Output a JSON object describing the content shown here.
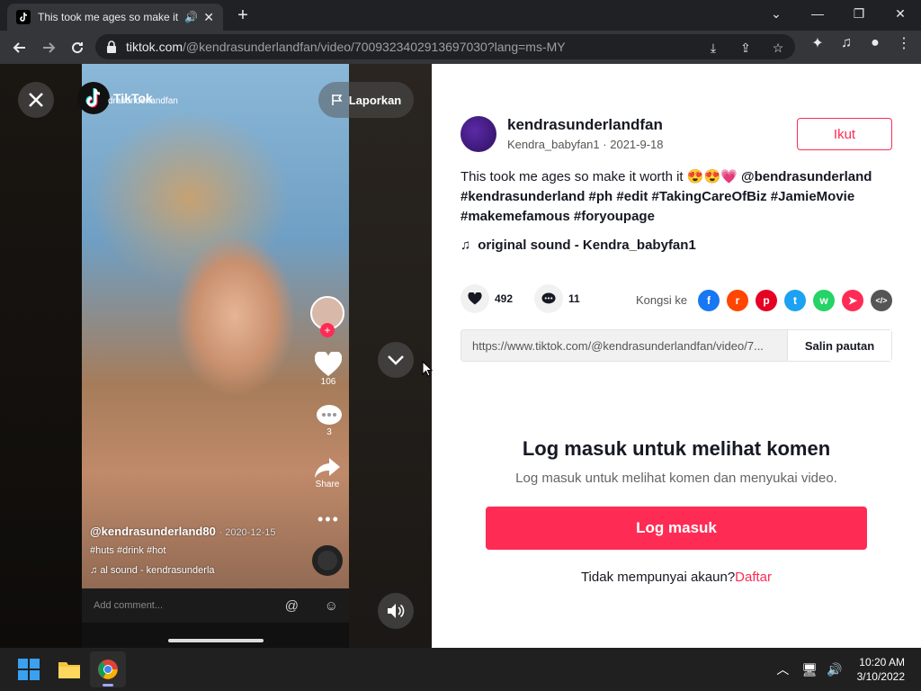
{
  "browser": {
    "tab_title": "This took me ages so make it",
    "url_host": "tiktok.com",
    "url_path": "/@kendrasunderlandfan/video/7009323402913697030?lang=ms-MY"
  },
  "video": {
    "logo_text": "TikTok",
    "logo_user": "drasunderlandfan",
    "report_label": "Laporkan",
    "like_count": "106",
    "comment_count": "3",
    "share_label": "Share",
    "caption_user": "@kendrasunderland80",
    "caption_date": "2020-12-15",
    "caption_tags": "#huts #drink #hot",
    "caption_sound": "al sound - kendrasunderla",
    "comment_placeholder": "Add comment..."
  },
  "panel": {
    "author_name": "kendrasunderlandfan",
    "author_handle": "Kendra_babyfan1",
    "author_date": "2021-9-18",
    "follow_label": "Ikut",
    "desc_text": "This took me ages so make it worth it 😍😍💗 ",
    "desc_mention": "@bendrasunderland",
    "desc_tags": "#kendrasunderland #ph #edit #TakingCareOfBiz #JamieMovie #makemefamous #foryoupage",
    "music": "original sound - Kendra_babyfan1",
    "likes": "492",
    "comments": "11",
    "share_label": "Kongsi ke",
    "link_url": "https://www.tiktok.com/@kendrasunderlandfan/video/7...",
    "copy_label": "Salin pautan",
    "login_title": "Log masuk untuk melihat komen",
    "login_sub": "Log masuk untuk melihat komen dan menyukai video.",
    "login_btn": "Log masuk",
    "no_account": "Tidak mempunyai akaun?",
    "signup_link": "Daftar"
  },
  "share_targets": [
    {
      "name": "facebook",
      "color": "#1877f2",
      "glyph": "f"
    },
    {
      "name": "reddit",
      "color": "#ff4500",
      "glyph": "r"
    },
    {
      "name": "pinterest",
      "color": "#e60023",
      "glyph": "p"
    },
    {
      "name": "twitter",
      "color": "#1da1f2",
      "glyph": "t"
    },
    {
      "name": "whatsapp",
      "color": "#25d366",
      "glyph": "w"
    },
    {
      "name": "telegram",
      "color": "#fe2c55",
      "glyph": "➤"
    },
    {
      "name": "embed",
      "color": "#555555",
      "glyph": "</>"
    }
  ],
  "taskbar": {
    "time": "10:20 AM",
    "date": "3/10/2022"
  }
}
